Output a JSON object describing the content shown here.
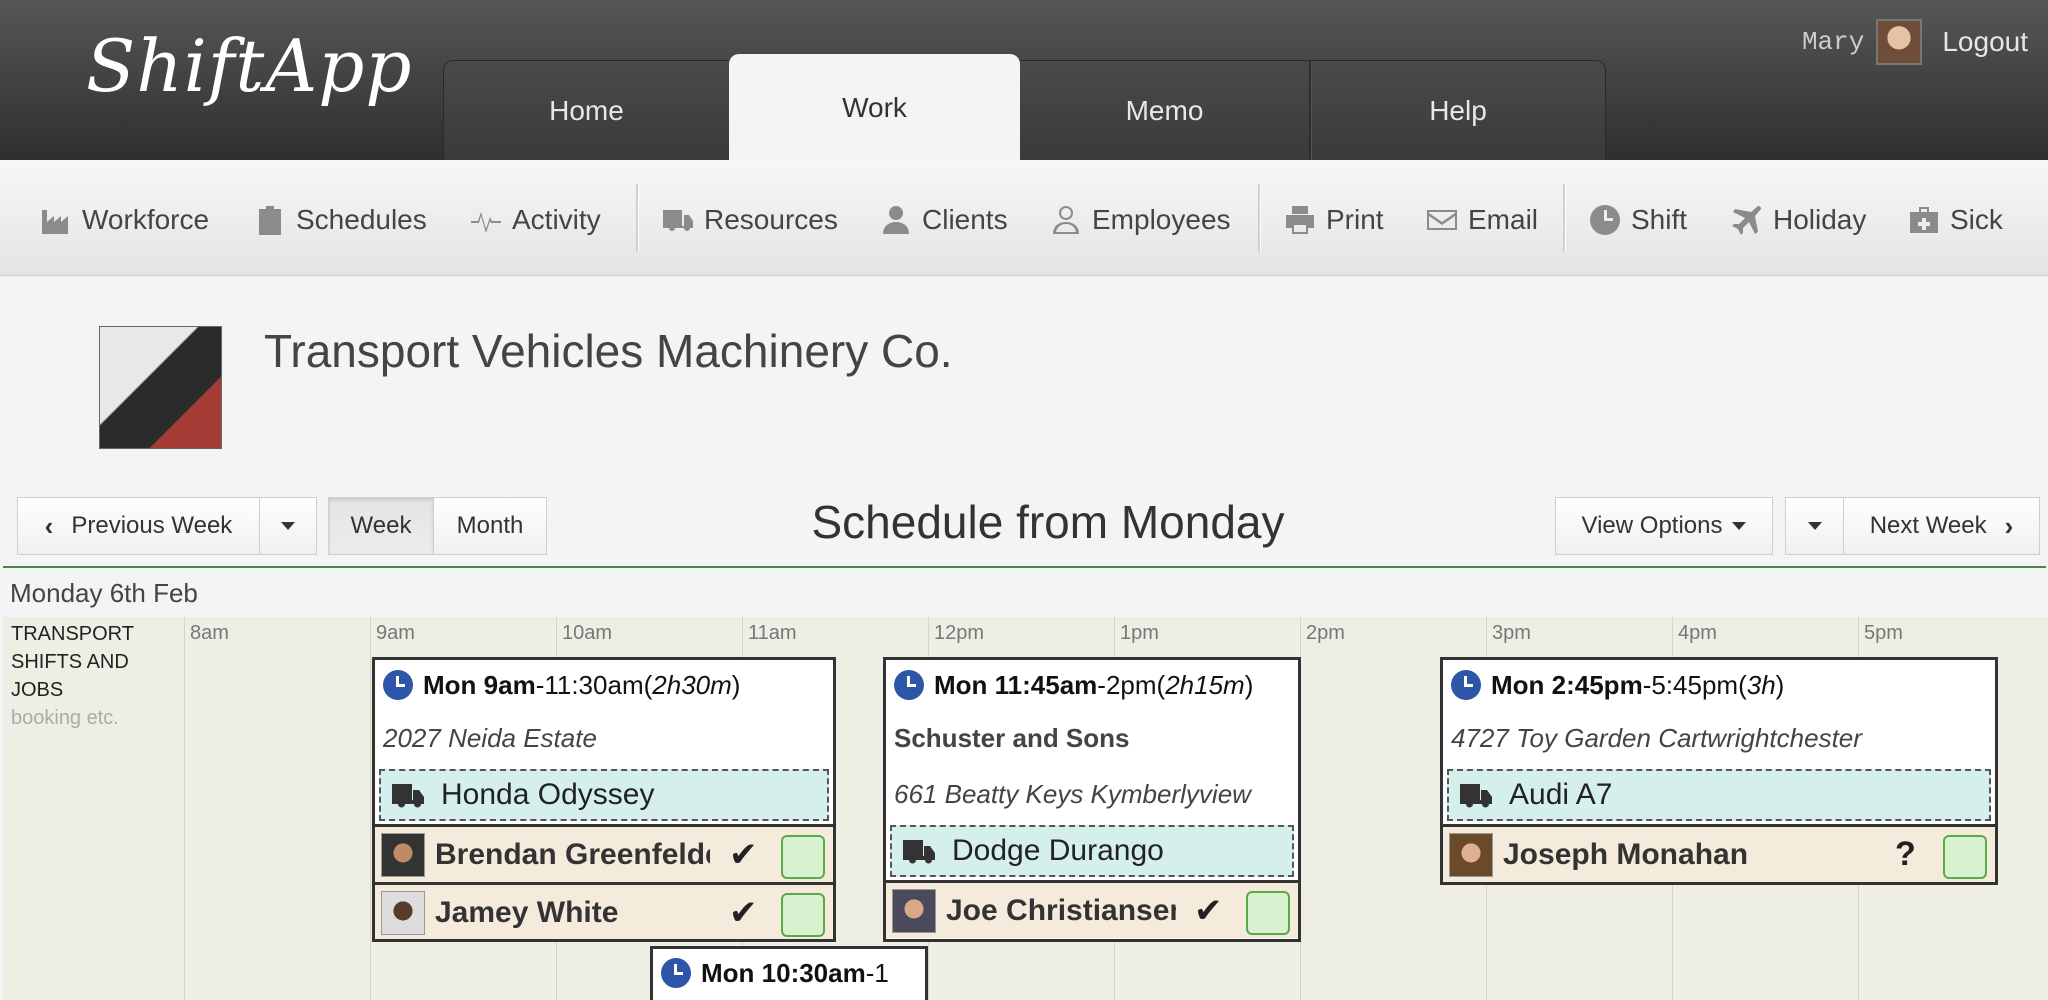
{
  "app": {
    "logo": "ShiftApp",
    "tabs": [
      {
        "label": "Home",
        "active": false
      },
      {
        "label": "Work",
        "active": true
      },
      {
        "label": "Memo",
        "active": false
      },
      {
        "label": "Help",
        "active": false
      }
    ],
    "user_name": "Mary",
    "logout_label": "Logout"
  },
  "toolbar": {
    "workforce": "Workforce",
    "schedules": "Schedules",
    "activity": "Activity",
    "resources": "Resources",
    "clients": "Clients",
    "employees": "Employees",
    "print": "Print",
    "email": "Email",
    "shift": "Shift",
    "holiday": "Holiday",
    "sick": "Sick"
  },
  "company": {
    "name": "Transport Vehicles Machinery Co."
  },
  "nav": {
    "prev_week": "Previous Week",
    "week": "Week",
    "month": "Month",
    "title": "Schedule from Monday",
    "view_options": "View Options",
    "next_week": "Next Week"
  },
  "schedule": {
    "day_label": "Monday 6th Feb",
    "row_label_line1": "TRANSPORT",
    "row_label_line2": "SHIFTS AND",
    "row_label_line3": "JOBS",
    "row_label_sub": "booking etc.",
    "hours": [
      "8am",
      "9am",
      "10am",
      "11am",
      "12pm",
      "1pm",
      "2pm",
      "3pm",
      "4pm",
      "5pm"
    ],
    "shifts": [
      {
        "start": "Mon 9am",
        "end": "-11:30am",
        "dur_open": " (",
        "duration": "2h30m",
        "dur_close": ")",
        "address": "2027 Neida Estate",
        "vehicle": "Honda Odyssey",
        "people": [
          {
            "name": "Brendan Greenfelder",
            "status": "✔"
          },
          {
            "name": "Jamey White",
            "status": "✔"
          }
        ]
      },
      {
        "start": "Mon 11:45am",
        "end": "-2pm",
        "dur_open": " (",
        "duration": "2h15m",
        "dur_close": ")",
        "client": "Schuster and Sons",
        "address": "661 Beatty Keys Kymberlyview",
        "vehicle": "Dodge Durango",
        "people": [
          {
            "name": "Joe Christiansen",
            "status": "✔"
          }
        ]
      },
      {
        "start": "Mon 2:45pm",
        "end": "-5:45pm",
        "dur_open": " (",
        "duration": "3h",
        "dur_close": ")",
        "address": "4727 Toy Garden Cartwrightchester",
        "vehicle": "Audi A7",
        "people": [
          {
            "name": "Joseph Monahan",
            "status": "?"
          }
        ]
      },
      {
        "start": "Mon 10:30am",
        "end": "-1"
      }
    ]
  },
  "colors": {
    "header_dark": "#2f2f2f",
    "accent_rule": "#4a8a3a",
    "clock_blue": "#2d55a8",
    "vehicle_bg": "#d5f0ec",
    "person_bg": "#f5ebdd",
    "status_box": "#d8f2cf"
  }
}
